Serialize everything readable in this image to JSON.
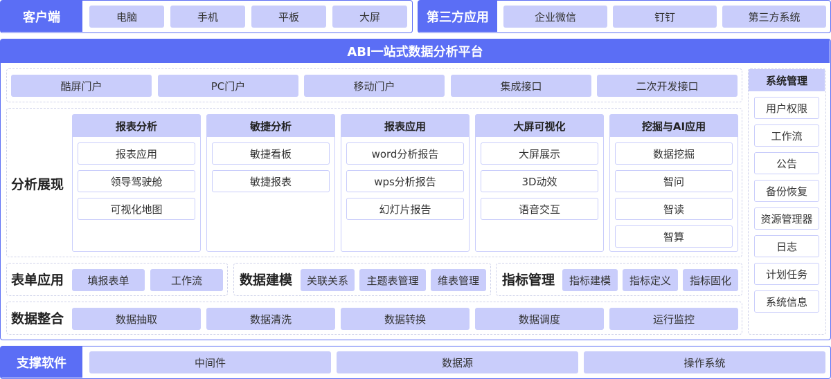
{
  "client": {
    "label": "客户端",
    "items": [
      "电脑",
      "手机",
      "平板",
      "大屏"
    ]
  },
  "third_party": {
    "label": "第三方应用",
    "items": [
      "企业微信",
      "钉钉",
      "第三方系统"
    ]
  },
  "platform": {
    "title": "ABI一站式数据分析平台"
  },
  "portals": [
    "酷屏门户",
    "PC门户",
    "移动门户",
    "集成接口",
    "二次开发接口"
  ],
  "analysis": {
    "label": "分析展现",
    "columns": [
      {
        "title": "报表分析",
        "items": [
          "报表应用",
          "领导驾驶舱",
          "可视化地图"
        ]
      },
      {
        "title": "敏捷分析",
        "items": [
          "敏捷看板",
          "敏捷报表"
        ]
      },
      {
        "title": "报表应用",
        "items": [
          "word分析报告",
          "wps分析报告",
          "幻灯片报告"
        ]
      },
      {
        "title": "大屏可视化",
        "items": [
          "大屏展示",
          "3D动效",
          "语音交互"
        ]
      },
      {
        "title": "挖掘与AI应用",
        "items": [
          "数据挖掘",
          "智问",
          "智读",
          "智算"
        ]
      }
    ]
  },
  "form_app": {
    "label": "表单应用",
    "items": [
      "填报表单",
      "工作流"
    ]
  },
  "data_modeling": {
    "label": "数据建模",
    "items": [
      "关联关系",
      "主题表管理",
      "维表管理"
    ]
  },
  "metrics": {
    "label": "指标管理",
    "items": [
      "指标建模",
      "指标定义",
      "指标固化"
    ]
  },
  "integration": {
    "label": "数据整合",
    "items": [
      "数据抽取",
      "数据清洗",
      "数据转换",
      "数据调度",
      "运行监控"
    ]
  },
  "system_mgmt": {
    "title": "系统管理",
    "items": [
      "用户权限",
      "工作流",
      "公告",
      "备份恢复",
      "资源管理器",
      "日志",
      "计划任务",
      "系统信息"
    ]
  },
  "support": {
    "label": "支撑软件",
    "items": [
      "中间件",
      "数据源",
      "操作系统"
    ]
  }
}
